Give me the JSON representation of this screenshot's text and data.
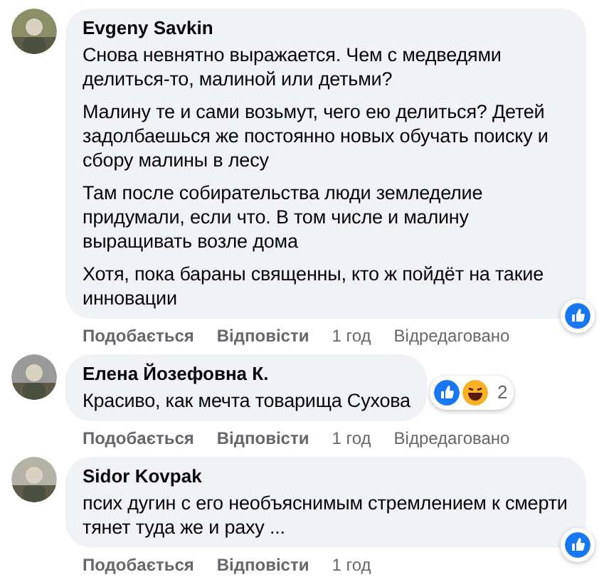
{
  "comments": [
    {
      "author": "Evgeny Savkin",
      "paragraphs": [
        "Снова невнятно выражается. Чем с медведями делиться-то, малиной или детьми?",
        "Малину те и сами возьмут, чего ею делиться? Детей задолбаешься же постоянно новых обучать поиску и сбору малины в лесу",
        "Там после собирательства люди земледелие придумали, если что. В том числе и малину выращивать возле дома",
        "Хотя, пока бараны священны, кто ж пойдёт на такие инновации"
      ],
      "reactions": [
        {
          "kind": "like"
        }
      ],
      "actions": [
        "Подобається",
        "Відповісти"
      ],
      "time": "1 год",
      "edited": "Відредаговано"
    },
    {
      "author": "Елена Йозефовна К.",
      "paragraphs": [
        "Красиво, как мечта товарища Сухова"
      ],
      "reactions": [
        {
          "kind": "like"
        },
        {
          "kind": "haha"
        }
      ],
      "reaction_count": "2",
      "actions": [
        "Подобається",
        "Відповісти"
      ],
      "time": "1 год",
      "edited": "Відредаговано"
    },
    {
      "author": "Sidor Kovpak",
      "paragraphs": [
        "псих дугин с его необъяснимым стремлением к смерти тянет туда же и раху ..."
      ],
      "reactions": [
        {
          "kind": "like"
        }
      ],
      "actions": [
        "Подобається",
        "Відповісти"
      ],
      "time": "1 год"
    }
  ]
}
